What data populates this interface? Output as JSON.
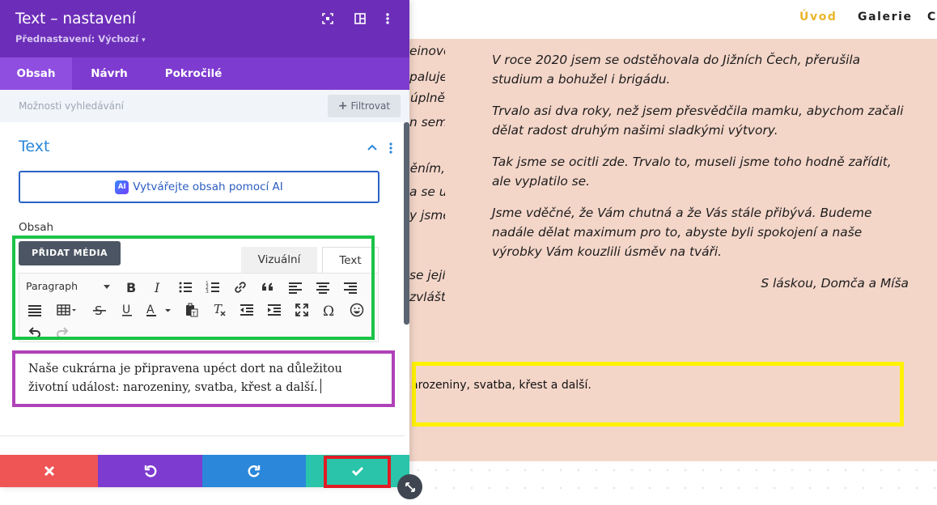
{
  "site": {
    "nav": [
      {
        "label": "Úvod",
        "active": true
      },
      {
        "label": "Galerie",
        "active": false
      },
      {
        "label": "C",
        "active": false
      }
    ],
    "left_fragments": [
      "einové",
      "paluje,",
      "úplně",
      "n sem",
      "ěním,",
      "a se u",
      "y jsme",
      "se její",
      "zvlášť"
    ],
    "story": [
      "V roce 2020 jsem se odstěhovala do Jižních Čech, přerušila studium a bohužel i brigádu.",
      "Trvalo asi dva roky, než jsem přesvědčila mamku, abychom začali dělat radost druhým našimi sladkými výtvory.",
      "Tak jsme se ocitli zde. Trvalo to, museli jsme toho hodně zařídit, ale vyplatilo se.",
      "Jsme vděčné, že Vám chutná a že Vás stále přibývá. Budeme nadále dělat maximum pro to, abyste byli spokojení a naše výrobky Vám kouzlili úsměv na tváři."
    ],
    "signature": "S láskou, Domča a Míša",
    "preview_text": "arozeniny, svatba, křest a další."
  },
  "panel": {
    "title": "Text – nastavení",
    "preset": "Přednastavení: Výchozí",
    "header_icons": [
      "focus-icon",
      "layout-toggle-icon",
      "kebab-menu-icon"
    ],
    "tabs": [
      {
        "label": "Obsah",
        "active": true
      },
      {
        "label": "Návrh",
        "active": false
      },
      {
        "label": "Pokročilé",
        "active": false
      }
    ],
    "search_placeholder": "Možnosti vyhledávání",
    "filter_label": "Filtrovat",
    "section_title": "Text",
    "ai_button": "Vytvářejte obsah pomocí AI",
    "ai_badge": "AI",
    "content_label": "Obsah",
    "add_media": "PŘIDAT MÉDIA",
    "mode_visual": "Vizuální",
    "mode_text": "Text",
    "format_select": "Paragraph",
    "editor_content": "Naše cukrárna je připravena upéct dort na důležitou životní událost: narozeniny, svatba, křest a další."
  },
  "colors": {
    "header_purple": "#6c2eb9",
    "tab_purple": "#7e3bd0",
    "accent_blue": "#2b87da",
    "cancel_red": "#ef5555",
    "save_teal": "#29c4a9",
    "nav_active_gold": "#e8b62c",
    "highlight_green": "#1bc346",
    "highlight_purple": "#b042b8",
    "highlight_yellow": "#fff200",
    "highlight_red": "#e01b24"
  }
}
